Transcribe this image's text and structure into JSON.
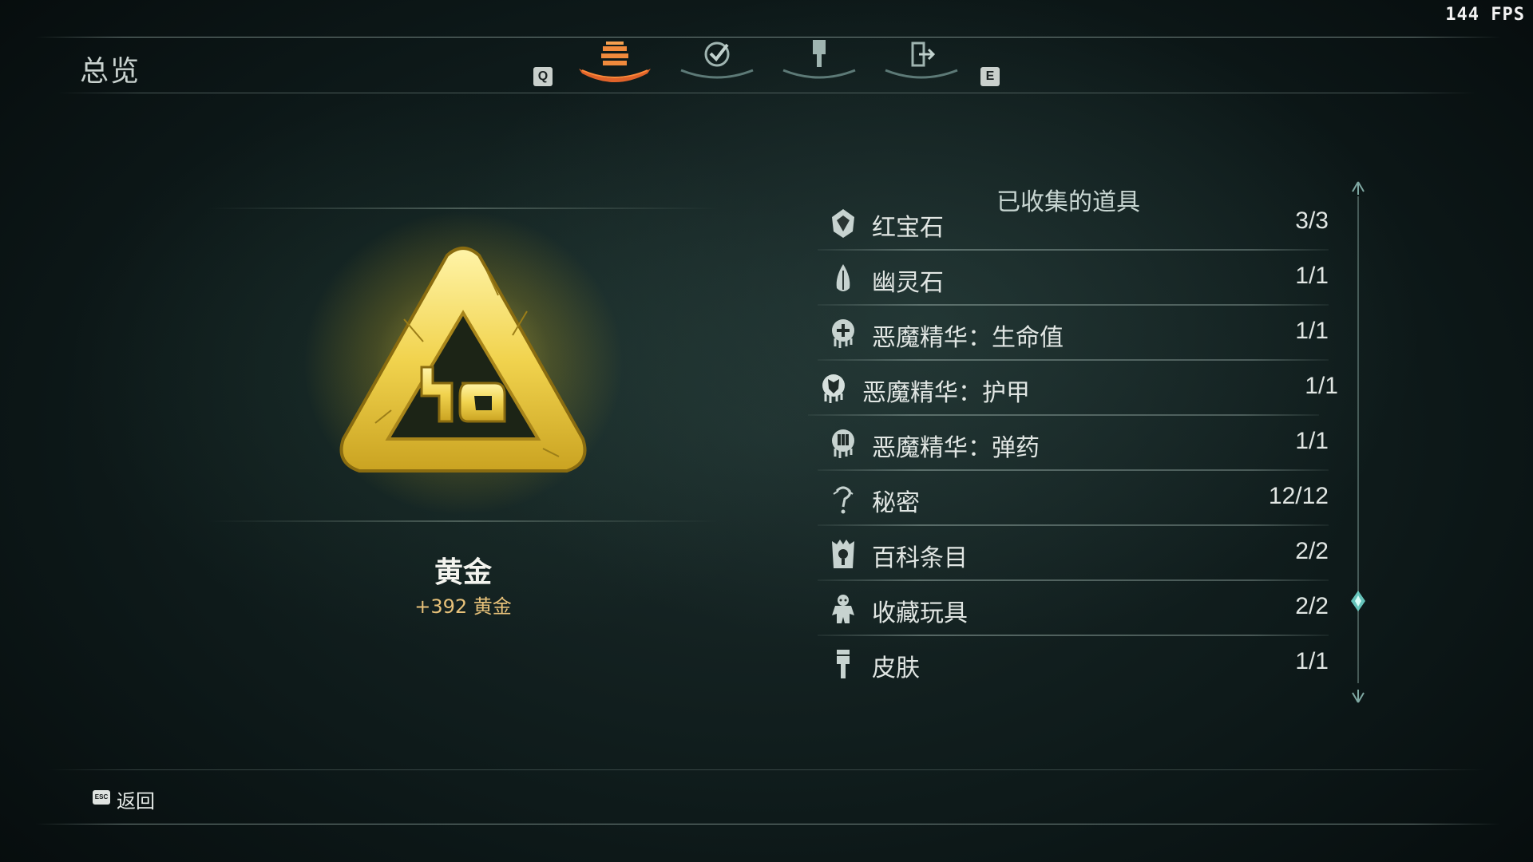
{
  "fps": "144 FPS",
  "header": {
    "title": "总览",
    "prev_key": "Q",
    "next_key": "E",
    "tabs": [
      {
        "icon": "stack-icon",
        "active": true
      },
      {
        "icon": "checkmark-icon",
        "active": false
      },
      {
        "icon": "paintbrush-icon",
        "active": false
      },
      {
        "icon": "door-exit-icon",
        "active": false
      }
    ]
  },
  "item": {
    "name": "黄金",
    "reward": "+392  黄金",
    "icon": "gold-triangle-emblem",
    "glow_color": "#f2d444"
  },
  "collected": {
    "title": "已收集的道具",
    "rows": [
      {
        "icon": "ruby-icon",
        "label": "红宝石",
        "count": "3/3"
      },
      {
        "icon": "ghost-stone-icon",
        "label": "幽灵石",
        "count": "1/1"
      },
      {
        "icon": "demon-essence-health-icon",
        "label": "恶魔精华：生命值",
        "count": "1/1"
      },
      {
        "icon": "demon-essence-armor-icon",
        "label": "恶魔精华：护甲",
        "count": "1/1",
        "selected": true
      },
      {
        "icon": "demon-essence-ammo-icon",
        "label": "恶魔精华：弹药",
        "count": "1/1"
      },
      {
        "icon": "secret-icon",
        "label": "秘密",
        "count": "12/12"
      },
      {
        "icon": "codex-icon",
        "label": "百科条目",
        "count": "2/2"
      },
      {
        "icon": "toy-icon",
        "label": "收藏玩具",
        "count": "2/2"
      },
      {
        "icon": "skin-icon",
        "label": "皮肤",
        "count": "1/1"
      }
    ]
  },
  "footer": {
    "esc_key": "ESC",
    "back_label": "返回"
  },
  "colors": {
    "accent": "#e0632a",
    "gold": "#f0d04a",
    "reward_text": "#e8c27a",
    "scroll_accent": "#6fd6cc"
  }
}
